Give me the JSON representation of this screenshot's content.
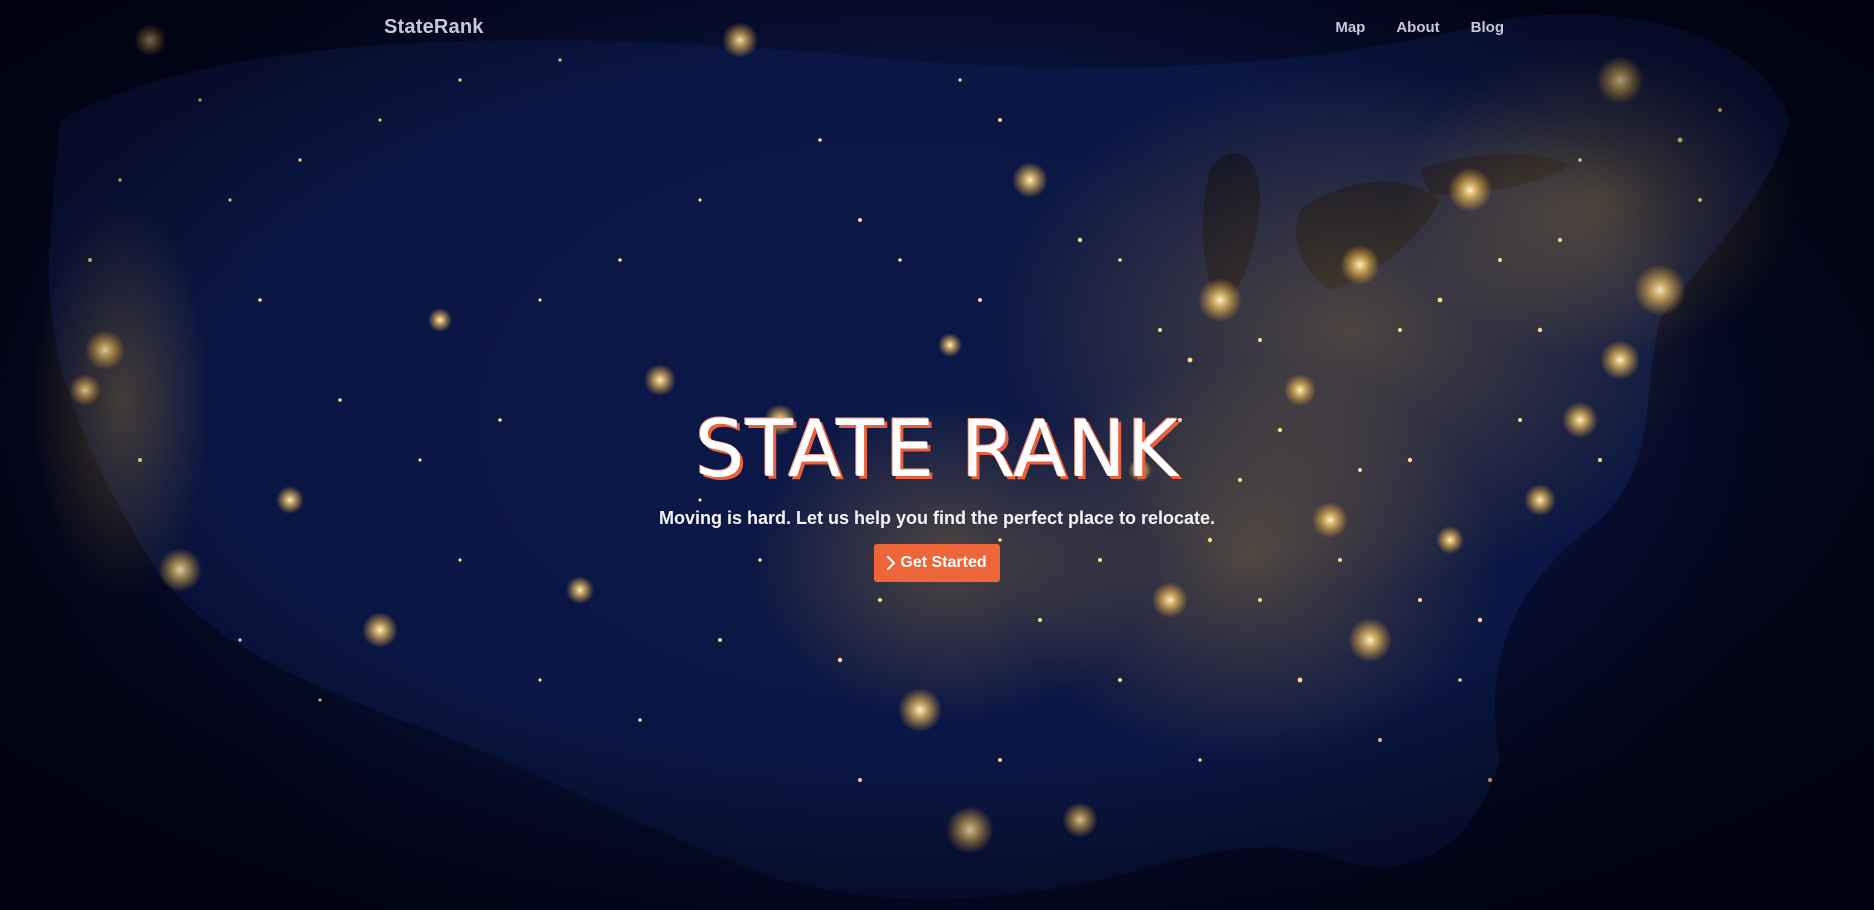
{
  "navbar": {
    "brand": "StateRank",
    "links": [
      "Map",
      "About",
      "Blog"
    ]
  },
  "hero": {
    "title": "STATE RANK",
    "subtitle": "Moving is hard. Let us help you find the perfect place to relocate.",
    "cta_label": "Get Started",
    "cta_icon": "chevron-right-icon"
  },
  "colors": {
    "background": "#0a1440",
    "accent": "#ee6539",
    "nav_text": "#c6c9d6",
    "city_lights": "#ffd98a"
  }
}
